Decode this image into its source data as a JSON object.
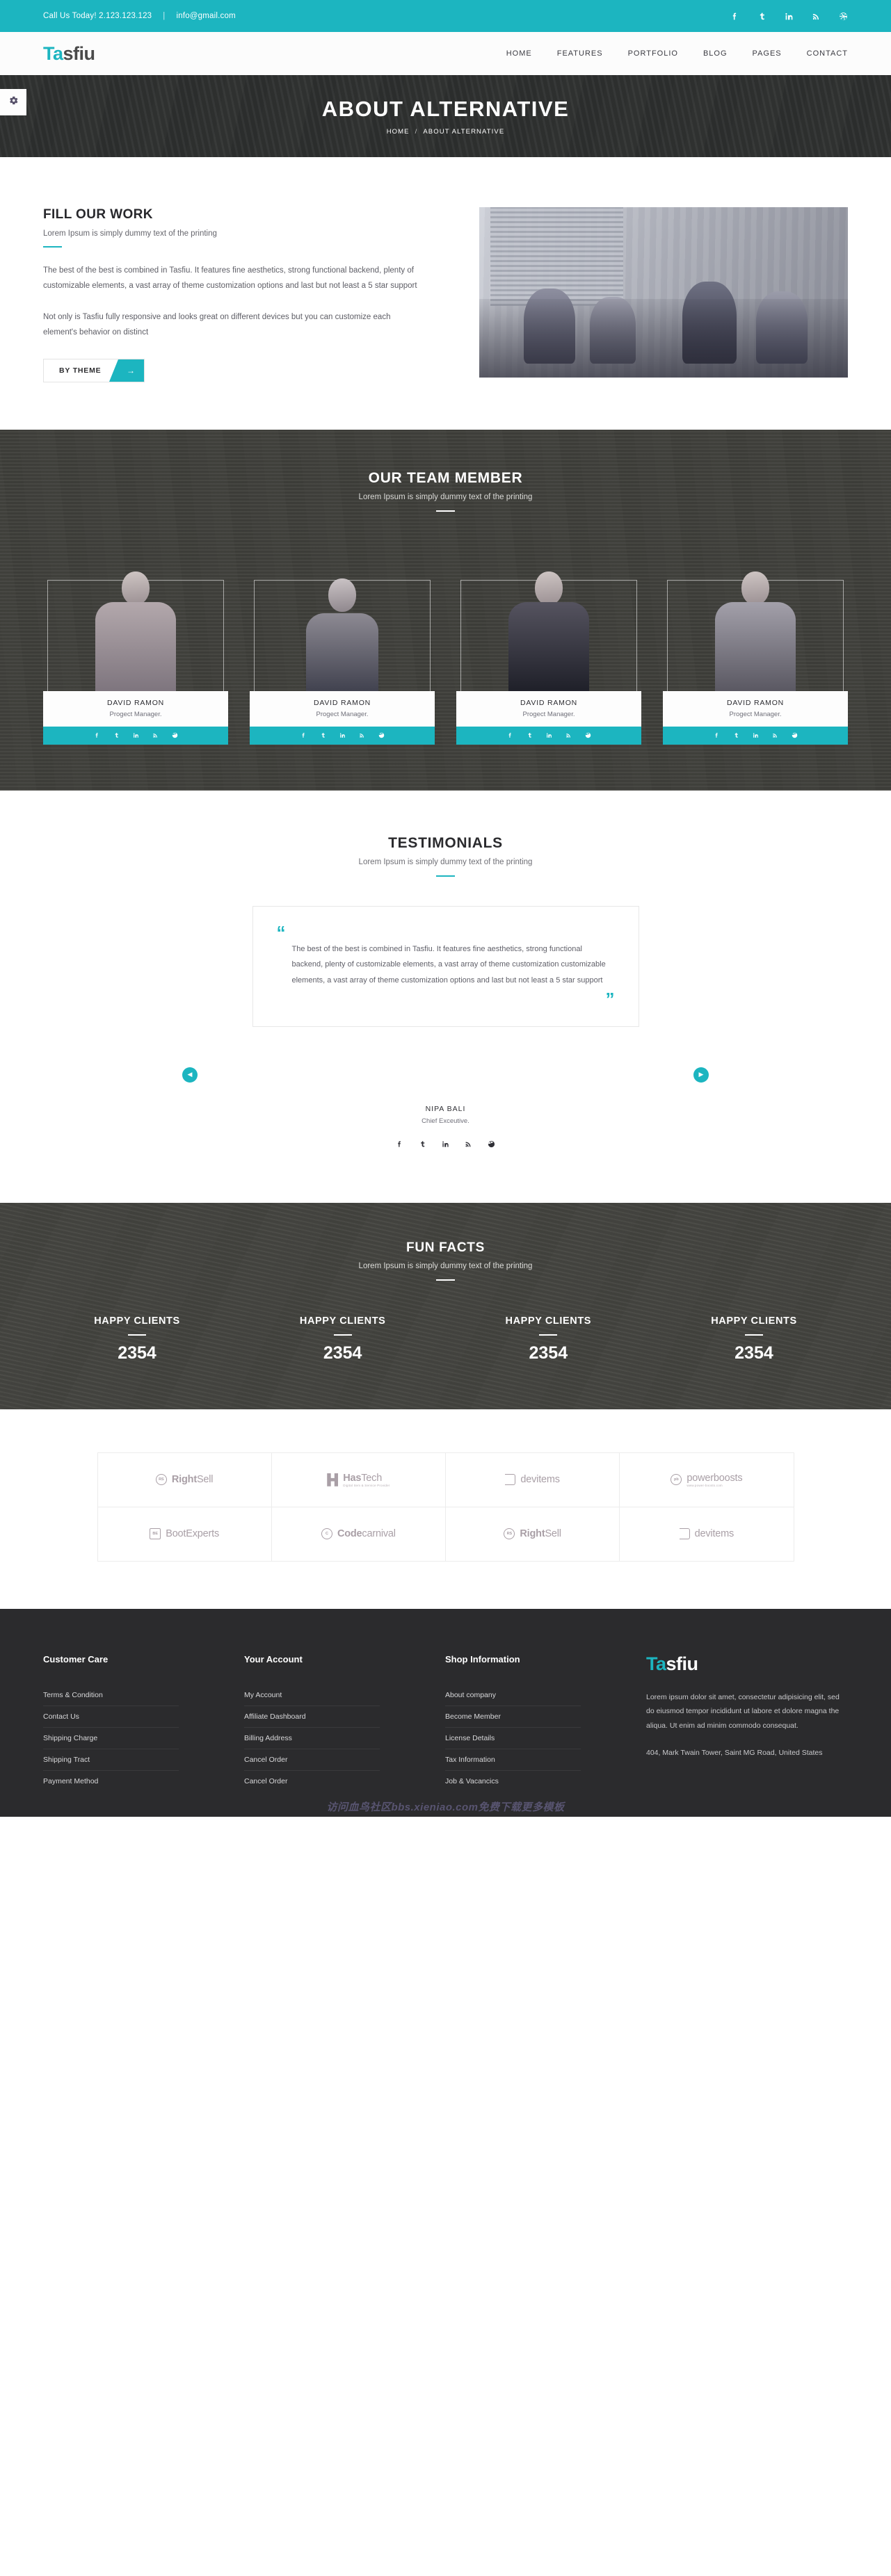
{
  "colors": {
    "accent": "#1cb5c0",
    "dark": "#2b2b2d",
    "hero_overlay": "#3e3e3a"
  },
  "topbar": {
    "call_text": "Call Us Today! 2.123.123.123",
    "separator": "|",
    "email": "info@gmail.com",
    "social": [
      "facebook-icon",
      "twitter-icon",
      "linkedin-icon",
      "rss-icon",
      "dribbble-icon"
    ]
  },
  "header": {
    "logo_accent": "Ta",
    "logo_rest": "sfiu",
    "nav": [
      "HOME",
      "FEATURES",
      "PORTFOLIO",
      "BLOG",
      "PAGES",
      "CONTACT"
    ]
  },
  "hero": {
    "title": "ABOUT ALTERNATIVE",
    "crumb_home": "HOME",
    "crumb_sep": "/",
    "crumb_current": "ABOUT ALTERNATIVE",
    "settings_icon": "gear-icon"
  },
  "fill": {
    "title": "FILL OUR WORK",
    "subtitle": "Lorem Ipsum is simply dummy text of the printing",
    "paragraph1": "The best of the best is combined in Tasfiu. It features fine aesthetics, strong functional backend, plenty of customizable elements, a vast array of theme customization options and last but not least a 5 star support",
    "paragraph2": "Not only is Tasfiu fully responsive and looks great on different devices but you can customize each element's behavior on distinct",
    "button_label": "BY THEME",
    "button_icon": "arrow-right-icon"
  },
  "team": {
    "title": "OUR TEAM MEMBER",
    "subtitle": "Lorem Ipsum is simply dummy text of the printing",
    "members": [
      {
        "name": "DAVID RAMON",
        "role": "Progect Manager."
      },
      {
        "name": "DAVID RAMON",
        "role": "Progect Manager."
      },
      {
        "name": "DAVID RAMON",
        "role": "Progect Manager."
      },
      {
        "name": "DAVID RAMON",
        "role": "Progect Manager."
      }
    ],
    "social": [
      "facebook-icon",
      "twitter-icon",
      "linkedin-icon",
      "rss-icon",
      "dribbble-icon"
    ]
  },
  "testimonials": {
    "title": "TESTIMONIALS",
    "subtitle": "Lorem Ipsum is simply dummy text of the printing",
    "quote_open": "“",
    "quote_close": "”",
    "quote": "The best of the best is combined in Tasfiu. It features fine aesthetics, strong functional backend, plenty of customizable elements, a vast array of theme customization customizable elements, a vast array of theme customization options and last but not least a 5 star support",
    "author_name": "NIPA BALI",
    "author_role": "Chief Exceutive.",
    "prev_icon": "chevron-left-icon",
    "next_icon": "chevron-right-icon",
    "social": [
      "facebook-icon",
      "twitter-icon",
      "linkedin-icon",
      "rss-icon",
      "dribbble-icon"
    ]
  },
  "facts": {
    "title": "FUN FACTS",
    "subtitle": "Lorem Ipsum is simply dummy text of the printing",
    "items": [
      {
        "label": "HAPPY CLIENTS",
        "value": "2354"
      },
      {
        "label": "HAPPY CLIENTS",
        "value": "2354"
      },
      {
        "label": "HAPPY CLIENTS",
        "value": "2354"
      },
      {
        "label": "HAPPY CLIENTS",
        "value": "2354"
      }
    ]
  },
  "clients": [
    {
      "mark": "RS",
      "name_bold": "Right",
      "name_rest": "Sell",
      "sub": "",
      "style": "circle"
    },
    {
      "mark": "H",
      "name_bold": "Has",
      "name_rest": "Tech",
      "sub": "Digital Item & Service Provider",
      "style": "hbar"
    },
    {
      "mark": "iD",
      "name_bold": "",
      "name_rest": "devitems",
      "sub": "",
      "style": "dbox"
    },
    {
      "mark": "pb",
      "name_bold": "",
      "name_rest": "powerboosts",
      "sub": "www.power-boosts.com",
      "style": "circle"
    },
    {
      "mark": "BE",
      "name_bold": "",
      "name_rest": "BootExperts",
      "sub": "",
      "style": "square"
    },
    {
      "mark": "C",
      "name_bold": "Code",
      "name_rest": "carnival",
      "sub": "",
      "style": "circle"
    },
    {
      "mark": "RS",
      "name_bold": "Right",
      "name_rest": "Sell",
      "sub": "",
      "style": "circle"
    },
    {
      "mark": "iD",
      "name_bold": "",
      "name_rest": "devitems",
      "sub": "",
      "style": "dbox"
    }
  ],
  "footer": {
    "col1": {
      "title": "Customer Care",
      "links": [
        "Terms & Condition",
        "Contact Us",
        "Shipping Charge",
        "Shipping Tract",
        "Payment Method"
      ]
    },
    "col2": {
      "title": "Your Account",
      "links": [
        "My Account",
        "Affiliate Dashboard",
        "Billing Address",
        "Cancel Order",
        "Cancel Order"
      ]
    },
    "col3": {
      "title": "Shop Information",
      "links": [
        "About company",
        "Become Member",
        "License Details",
        "Tax Information",
        "Job & Vacancics"
      ]
    },
    "brand": {
      "logo_accent": "Ta",
      "logo_rest": "sfiu",
      "text": "Lorem ipsum dolor sit amet, consectetur adipisicing elit, sed do eiusmod tempor incididunt ut labore et dolore magna the aliqua. Ut enim ad minim commodo consequat.",
      "address": "404, Mark Twain Tower, Saint MG Road, United States"
    },
    "watermark": "访问血鸟社区bbs.xieniao.com免费下载更多模板"
  }
}
